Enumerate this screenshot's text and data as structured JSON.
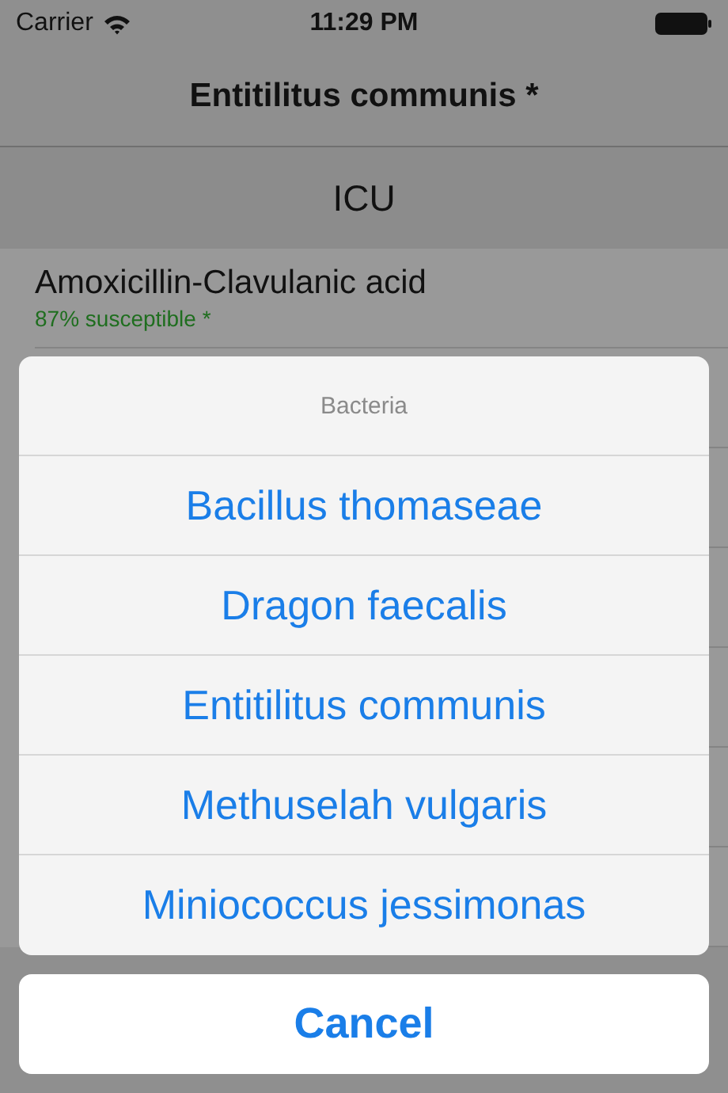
{
  "status_bar": {
    "carrier": "Carrier",
    "time": "11:29 PM"
  },
  "navigation": {
    "title": "Entitilitus communis *"
  },
  "location": {
    "label": "ICU"
  },
  "antibiotics": [
    {
      "name": "Amoxicillin-Clavulanic acid",
      "susceptibility": "87% susceptible *"
    }
  ],
  "action_sheet": {
    "title": "Bacteria",
    "options": [
      {
        "label": "Bacillus thomaseae"
      },
      {
        "label": "Dragon faecalis"
      },
      {
        "label": "Entitilitus communis"
      },
      {
        "label": "Methuselah vulgaris"
      },
      {
        "label": "Miniococcus jessimonas"
      }
    ],
    "cancel": "Cancel"
  }
}
